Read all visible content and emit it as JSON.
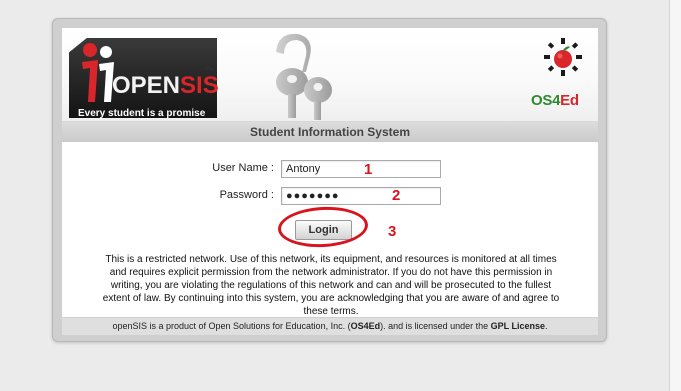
{
  "banner": {
    "logo_word_open": "OPEN",
    "logo_word_sis": "SIS",
    "logo_trademark": "™",
    "tagline": "Every student is a promise",
    "partner_logo_os4": "OS4",
    "partner_logo_ed": "Ed"
  },
  "title": "Student Information System",
  "form": {
    "username_label": "User Name :",
    "username_value": "Antony",
    "password_label": "Password :",
    "password_value": "●●●●●●●",
    "login_label": "Login"
  },
  "annotations": {
    "step1": "1",
    "step2": "2",
    "step3": "3"
  },
  "notice": {
    "line1": "This is a restricted network. Use of this network, its equipment, and resources is monitored at all times",
    "line2": "and requires explicit permission from the network administrator. If you do not have this permission in",
    "line3": "writing, you are violating the regulations of this network and can and will be prosecuted to the fullest",
    "line4": "extent of law. By continuing into this system, you are acknowledging that you are aware of and agree to",
    "line5": "these terms."
  },
  "footer": {
    "prefix": "openSIS is a product of Open Solutions for Education, Inc. (",
    "company_abbr": "OS4Ed",
    "middle": "). and is licensed under the ",
    "license": "GPL License",
    "suffix": "."
  },
  "colors": {
    "accent_red": "#d8262a",
    "annotation_red": "#d8141e",
    "os4ed_green": "#2e8b2e"
  },
  "icons": [
    "openSIS-figures-logo",
    "keys-graphic",
    "os4ed-gear-apple-logo"
  ]
}
